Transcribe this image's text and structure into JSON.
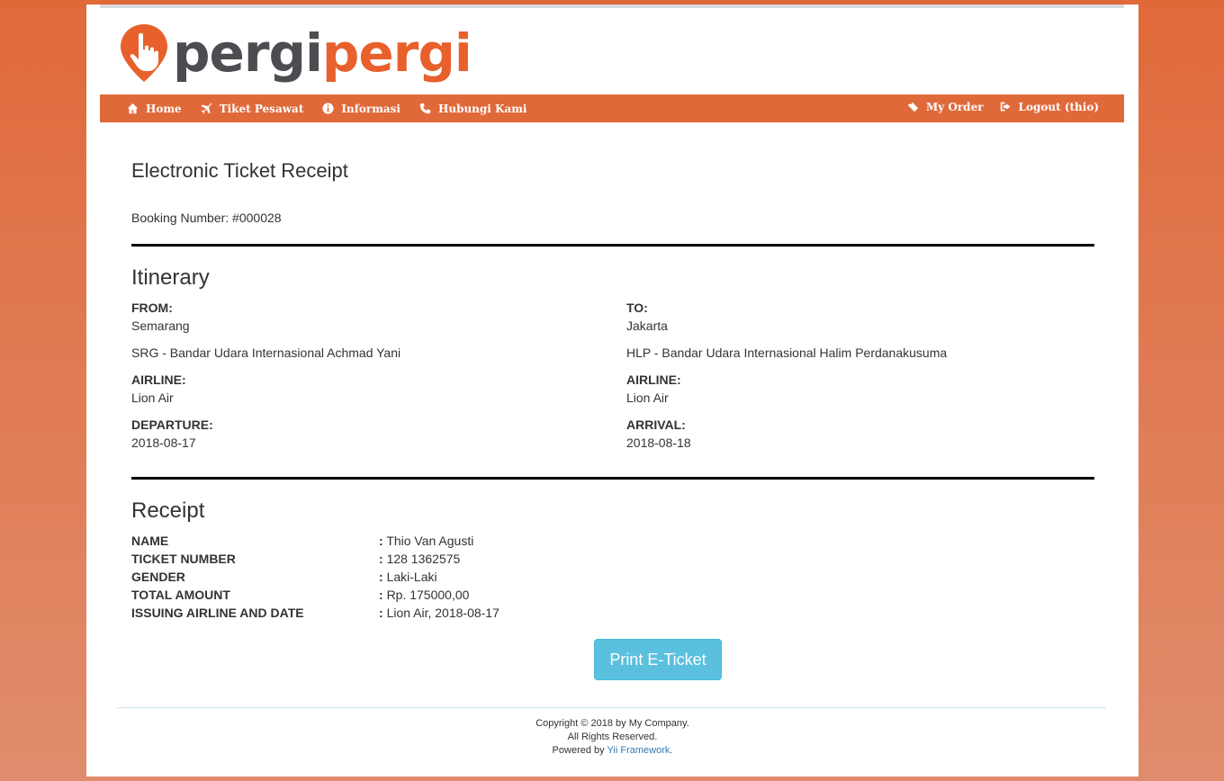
{
  "brand": {
    "part1": "pergi",
    "part2": "pergi"
  },
  "nav": {
    "left": [
      {
        "label": "Home",
        "icon": "home-icon"
      },
      {
        "label": "Tiket Pesawat",
        "icon": "plane-icon"
      },
      {
        "label": "Informasi",
        "icon": "info-icon"
      },
      {
        "label": "Hubungi Kami",
        "icon": "phone-icon"
      }
    ],
    "right": [
      {
        "label": "My Order",
        "icon": "ticket-icon"
      },
      {
        "label": "Logout (thio)",
        "icon": "logout-icon"
      }
    ]
  },
  "page": {
    "title": "Electronic Ticket Receipt",
    "booking_number": "Booking Number: #000028"
  },
  "itinerary": {
    "heading": "Itinerary",
    "from_label": "FROM:",
    "from_city": "Semarang",
    "from_airport": "SRG - Bandar Udara Internasional Achmad Yani",
    "to_label": "TO:",
    "to_city": "Jakarta",
    "to_airport": "HLP - Bandar Udara Internasional Halim Perdanakusuma",
    "airline_label": "AIRLINE:",
    "airline_from": "Lion Air",
    "airline_to": "Lion Air",
    "departure_label": "DEPARTURE:",
    "departure_date": "2018-08-17",
    "arrival_label": "ARRIVAL:",
    "arrival_date": "2018-08-18"
  },
  "receipt": {
    "heading": "Receipt",
    "rows": [
      {
        "label": "NAME",
        "value": "Thio Van Agusti"
      },
      {
        "label": "TICKET NUMBER",
        "value": "128 1362575"
      },
      {
        "label": "GENDER",
        "value": "Laki-Laki"
      },
      {
        "label": "TOTAL AMOUNT",
        "value": "Rp. 175000,00"
      },
      {
        "label": "ISSUING AIRLINE AND DATE",
        "value": "Lion Air, 2018-08-17"
      }
    ],
    "separator": ":"
  },
  "print_button": "Print E-Ticket",
  "footer": {
    "line1": "Copyright © 2018 by My Company.",
    "line2": "All Rights Reserved.",
    "powered_prefix": "Powered by ",
    "powered_link": "Yii Framework",
    "powered_suffix": "."
  },
  "colors": {
    "brand_orange": "#e0693a",
    "logo_gray": "#4b4d51",
    "button_info": "#5bc0de",
    "link": "#337ab7"
  }
}
